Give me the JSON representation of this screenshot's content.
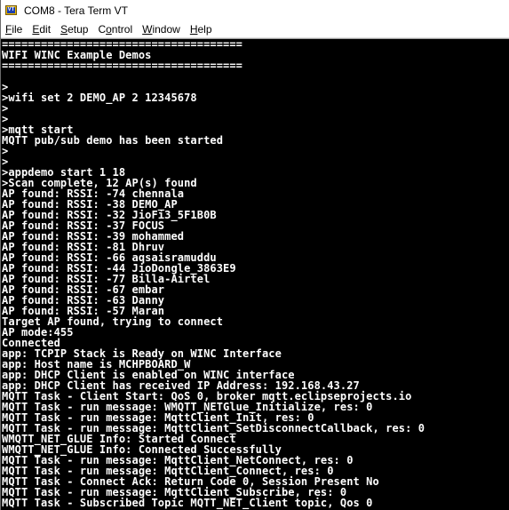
{
  "window": {
    "title": "COM8 - Tera Term VT",
    "icon": "tera-term-vt-icon"
  },
  "menu": [
    {
      "pre": "",
      "acc": "F",
      "post": "ile"
    },
    {
      "pre": "",
      "acc": "E",
      "post": "dit"
    },
    {
      "pre": "",
      "acc": "S",
      "post": "etup"
    },
    {
      "pre": "C",
      "acc": "o",
      "post": "ntrol"
    },
    {
      "pre": "",
      "acc": "W",
      "post": "indow"
    },
    {
      "pre": "",
      "acc": "H",
      "post": "elp"
    }
  ],
  "terminal": {
    "lines": [
      "=====================================",
      "WIFI WINC Example Demos",
      "=====================================",
      "",
      ">",
      ">wifi set 2 DEMO_AP 2 12345678",
      ">",
      ">",
      ">mqtt start",
      "MQTT pub/sub demo has been started",
      ">",
      ">",
      ">appdemo start 1 18",
      ">Scan complete, 12 AP(s) found",
      "AP found: RSSI: -74 chennala",
      "AP found: RSSI: -38 DEMO_AP",
      "AP found: RSSI: -32 JioFi3_5F1B0B",
      "AP found: RSSI: -37 FOCUS",
      "AP found: RSSI: -39 mohammed",
      "AP found: RSSI: -81 Dhruv",
      "AP found: RSSI: -66 aqsaisramuddu",
      "AP found: RSSI: -44 JioDongle_3863E9",
      "AP found: RSSI: -77 Billa-Airtel",
      "AP found: RSSI: -67 embar",
      "AP found: RSSI: -63 Danny",
      "AP found: RSSI: -57 Maran",
      "Target AP found, trying to connect",
      "AP mode:455",
      "Connected",
      "app: TCPIP Stack is Ready on WINC Interface",
      "app: Host name is MCHPBOARD_W",
      "app: DHCP Client is enabled on WINC interface",
      "app: DHCP Client has received IP Address: 192.168.43.27",
      "MQTT Task - Client Start: QoS 0, broker mqtt.eclipseprojects.io",
      "MQTT Task - run message: WMQTT_NETGlue_Initialize, res: 0",
      "MQTT Task - run message: MqttClient_Init, res: 0",
      "MQTT Task - run message: MqttClient_SetDisconnectCallback, res: 0",
      "WMQTT_NET_GLUE Info: Started Connect",
      "WMQTT_NET_GLUE Info: Connected Successfully",
      "MQTT Task - run message: MqttClient_NetConnect, res: 0",
      "MQTT Task - run message: MqttClient_Connect, res: 0",
      "MQTT Task - Connect Ack: Return Code 0, Session Present No",
      "MQTT Task - run message: MqttClient_Subscribe, res: 0",
      "MQTT Task - Subscribed Topic MQTT_NET_Client topic, Qos 0"
    ]
  }
}
